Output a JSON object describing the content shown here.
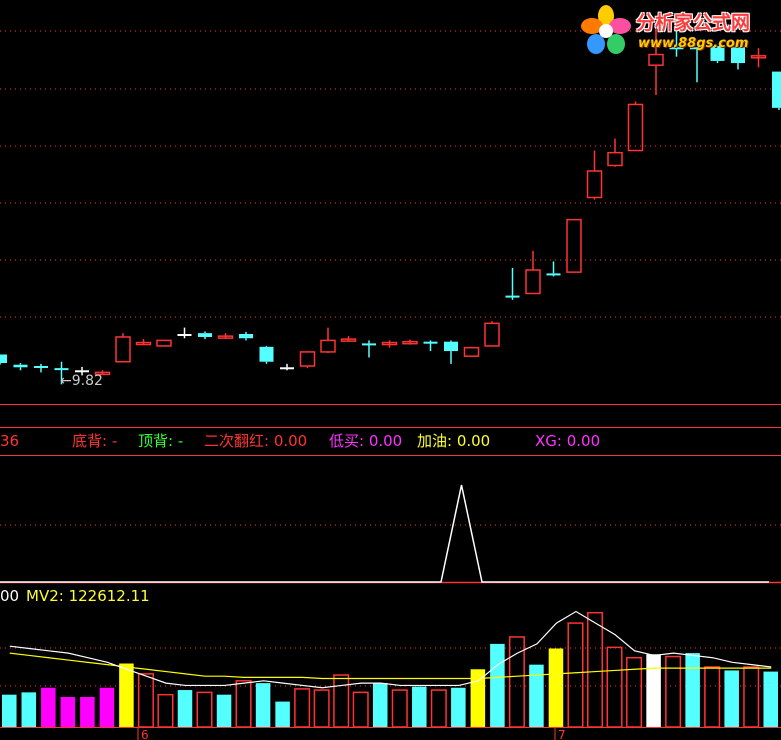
{
  "colors": {
    "background": "#000000",
    "up": "#ff3333",
    "down": "#54ffff",
    "flat": "#ffffff",
    "grid": "#ff3333",
    "mv_line": "#ffffff",
    "mv2_line": "#ffff00",
    "highlight_bar": "#ffff00",
    "magenta_bar": "#ff00ff",
    "indicator_line": "#ffffff"
  },
  "logo": {
    "title": "分析家公式网",
    "url": "www.88gs.com"
  },
  "indicator_labels": [
    {
      "key": "cut_value",
      "text": "36",
      "color": "#ff3333"
    },
    {
      "key": "dibei",
      "text": "底背: -",
      "color": "#ff3333"
    },
    {
      "key": "dingbei",
      "text": "顶背: -",
      "color": "#33ff33"
    },
    {
      "key": "erci",
      "text": "二次翻红: 0.00",
      "color": "#ff3333"
    },
    {
      "key": "dimai",
      "text": "低买: 0.00",
      "color": "#ff33ff"
    },
    {
      "key": "jiayou",
      "text": "加油: 0.00",
      "color": "#ffff33"
    },
    {
      "key": "xg",
      "text": "XG: 0.00",
      "color": "#ff33ff"
    }
  ],
  "volume_labels": {
    "cut_value": "00",
    "mv2": "MV2: 122612.11"
  },
  "price_annotation": {
    "arrow": "←",
    "value": "9.82"
  },
  "axis_markers": [
    "6",
    "7"
  ],
  "chart_data": [
    {
      "type": "candlestick",
      "panel": "price",
      "candles": [
        {
          "o": 10.62,
          "h": 10.62,
          "l": 10.38,
          "c": 10.42,
          "dir": "down"
        },
        {
          "o": 10.38,
          "h": 10.42,
          "l": 10.25,
          "c": 10.32,
          "dir": "down"
        },
        {
          "o": 10.32,
          "h": 10.4,
          "l": 10.2,
          "c": 10.35,
          "dir": "down"
        },
        {
          "o": 10.3,
          "h": 10.45,
          "l": 9.92,
          "c": 10.3,
          "dir": "down"
        },
        {
          "o": 10.25,
          "h": 10.33,
          "l": 10.13,
          "c": 10.25,
          "dir": "flat"
        },
        {
          "o": 10.2,
          "h": 10.25,
          "l": 10.15,
          "c": 10.2,
          "dir": "up"
        },
        {
          "o": 10.45,
          "h": 11.12,
          "l": 10.45,
          "c": 11.03,
          "dir": "up"
        },
        {
          "o": 10.9,
          "h": 10.98,
          "l": 10.85,
          "c": 10.9,
          "dir": "up"
        },
        {
          "o": 10.82,
          "h": 10.95,
          "l": 10.82,
          "c": 10.95,
          "dir": "up"
        },
        {
          "o": 11.1,
          "h": 11.25,
          "l": 11.0,
          "c": 11.1,
          "dir": "flat"
        },
        {
          "o": 11.12,
          "h": 11.16,
          "l": 10.98,
          "c": 11.03,
          "dir": "down"
        },
        {
          "o": 11.05,
          "h": 11.12,
          "l": 11.0,
          "c": 11.05,
          "dir": "up"
        },
        {
          "o": 11.1,
          "h": 11.15,
          "l": 10.95,
          "c": 11.0,
          "dir": "down"
        },
        {
          "o": 10.8,
          "h": 10.82,
          "l": 10.4,
          "c": 10.45,
          "dir": "down"
        },
        {
          "o": 10.32,
          "h": 10.4,
          "l": 10.25,
          "c": 10.32,
          "dir": "flat"
        },
        {
          "o": 10.35,
          "h": 10.7,
          "l": 10.3,
          "c": 10.68,
          "dir": "up"
        },
        {
          "o": 10.68,
          "h": 11.25,
          "l": 10.65,
          "c": 10.95,
          "dir": "up"
        },
        {
          "o": 10.98,
          "h": 11.05,
          "l": 10.92,
          "c": 10.98,
          "dir": "up"
        },
        {
          "o": 10.88,
          "h": 10.95,
          "l": 10.55,
          "c": 10.88,
          "dir": "down"
        },
        {
          "o": 10.9,
          "h": 10.95,
          "l": 10.78,
          "c": 10.9,
          "dir": "up"
        },
        {
          "o": 10.9,
          "h": 10.97,
          "l": 10.85,
          "c": 10.92,
          "dir": "up"
        },
        {
          "o": 10.92,
          "h": 10.95,
          "l": 10.7,
          "c": 10.92,
          "dir": "down"
        },
        {
          "o": 10.92,
          "h": 10.95,
          "l": 10.4,
          "c": 10.7,
          "dir": "down"
        },
        {
          "o": 10.58,
          "h": 10.8,
          "l": 10.58,
          "c": 10.78,
          "dir": "up"
        },
        {
          "o": 10.82,
          "h": 11.4,
          "l": 10.82,
          "c": 11.35,
          "dir": "up"
        },
        {
          "o": 12.0,
          "h": 12.65,
          "l": 11.9,
          "c": 11.98,
          "dir": "down"
        },
        {
          "o": 12.05,
          "h": 13.05,
          "l": 12.05,
          "c": 12.6,
          "dir": "up"
        },
        {
          "o": 12.52,
          "h": 12.8,
          "l": 12.45,
          "c": 12.52,
          "dir": "down"
        },
        {
          "o": 12.55,
          "h": 13.78,
          "l": 12.55,
          "c": 13.78,
          "dir": "up"
        },
        {
          "o": 14.3,
          "h": 15.4,
          "l": 14.25,
          "c": 14.92,
          "dir": "up"
        },
        {
          "o": 15.05,
          "h": 15.68,
          "l": 15.02,
          "c": 15.35,
          "dir": "up"
        },
        {
          "o": 15.4,
          "h": 16.55,
          "l": 15.4,
          "c": 16.48,
          "dir": "up"
        },
        {
          "o": 17.4,
          "h": 18.35,
          "l": 16.7,
          "c": 17.65,
          "dir": "up"
        },
        {
          "o": 17.82,
          "h": 18.2,
          "l": 17.6,
          "c": 17.82,
          "dir": "down"
        },
        {
          "o": 17.82,
          "h": 17.82,
          "l": 17.0,
          "c": 17.82,
          "dir": "down"
        },
        {
          "o": 17.85,
          "h": 17.85,
          "l": 17.45,
          "c": 17.5,
          "dir": "down"
        },
        {
          "o": 17.82,
          "h": 17.82,
          "l": 17.3,
          "c": 17.45,
          "dir": "down"
        },
        {
          "o": 17.62,
          "h": 17.8,
          "l": 17.35,
          "c": 17.62,
          "dir": "up"
        },
        {
          "o": 17.25,
          "h": 17.25,
          "l": 16.35,
          "c": 16.4,
          "dir": "down"
        }
      ]
    },
    {
      "type": "line",
      "panel": "indicator",
      "values": [
        0,
        0,
        0,
        0,
        0,
        0,
        0,
        0,
        0,
        0,
        0,
        0,
        0,
        0,
        0,
        0,
        0,
        0,
        0,
        0,
        0,
        0,
        0,
        1,
        0,
        0,
        0,
        0,
        0,
        0,
        0,
        0,
        0,
        0,
        0,
        0,
        0,
        0,
        0
      ]
    },
    {
      "type": "bar",
      "panel": "volume",
      "series": [
        {
          "name": "VOL",
          "values": [
            28000,
            30000,
            34000,
            26000,
            26000,
            34000,
            55000,
            46000,
            28000,
            32000,
            30000,
            28000,
            40000,
            38000,
            22000,
            33000,
            32000,
            45000,
            30000,
            38000,
            32000,
            35000,
            32000,
            34000,
            50000,
            72000,
            78000,
            54000,
            68000,
            90000,
            99000,
            69000,
            60000,
            63000,
            61000,
            64000,
            52000,
            49000,
            52000,
            48000
          ]
        },
        {
          "name": "MV",
          "values": [
            70000,
            68000,
            66000,
            64000,
            60000,
            56000,
            50000,
            44000,
            38000,
            36000,
            36000,
            36000,
            38000,
            40000,
            38000,
            36000,
            34000,
            36000,
            38000,
            38000,
            36000,
            36000,
            36000,
            36000,
            40000,
            54000,
            64000,
            72000,
            90000,
            100000,
            90000,
            80000,
            66000,
            62000,
            64000,
            62000,
            60000,
            56000,
            54000,
            52000
          ]
        },
        {
          "name": "MV2",
          "values": [
            64000,
            62000,
            60000,
            58000,
            56000,
            54000,
            52000,
            50000,
            48000,
            46000,
            44000,
            44000,
            43000,
            43000,
            43000,
            43000,
            42000,
            42000,
            42000,
            42000,
            42000,
            42000,
            42000,
            42000,
            42000,
            43000,
            44000,
            45000,
            46000,
            47000,
            48000,
            49000,
            50000,
            51000,
            51000,
            51000,
            51000,
            51000,
            51000,
            51000
          ]
        }
      ],
      "bar_styles": [
        "down",
        "down",
        "magenta",
        "magenta",
        "magenta",
        "magenta",
        "highlight",
        "up",
        "up",
        "down",
        "up",
        "down",
        "up",
        "down",
        "down",
        "up",
        "up",
        "up",
        "up",
        "down",
        "up",
        "down",
        "up",
        "down",
        "highlight",
        "down",
        "up",
        "down",
        "highlight",
        "up",
        "up",
        "up",
        "up",
        "white",
        "up",
        "down",
        "up",
        "down",
        "up",
        "down"
      ]
    }
  ]
}
